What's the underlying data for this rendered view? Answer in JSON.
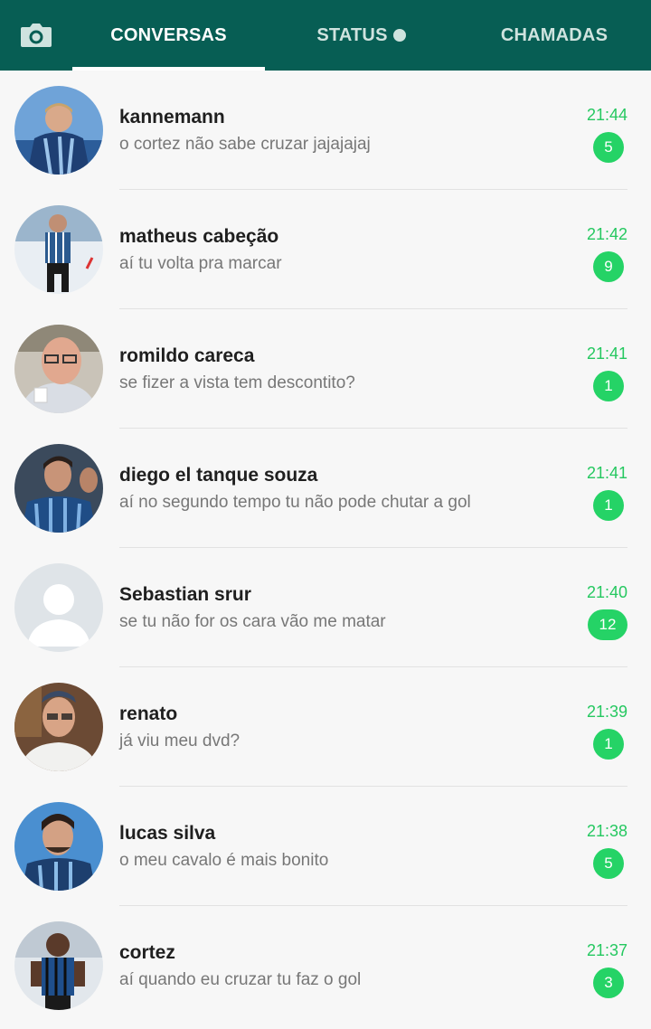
{
  "header": {
    "camera_icon": "camera-icon",
    "tabs": [
      {
        "label": "CONVERSAS",
        "active": true
      },
      {
        "label": "STATUS",
        "active": false
      },
      {
        "label": "CHAMADAS",
        "active": false
      }
    ],
    "colors": {
      "bar": "#075e54",
      "accent": "#25d366"
    }
  },
  "chats": [
    {
      "name": "kannemann",
      "message": "o cortez não sabe cruzar jajajajaj",
      "time": "21:44",
      "unread": "5",
      "avatar": "player-photo-blue-jersey"
    },
    {
      "name": "matheus cabeção",
      "message": "aí tu volta pra marcar",
      "time": "21:42",
      "unread": "9",
      "avatar": "player-photo-running"
    },
    {
      "name": "romildo careca",
      "message": "se fizer a vista tem descontito?",
      "time": "21:41",
      "unread": "1",
      "avatar": "man-with-glasses-photo"
    },
    {
      "name": "diego el tanque souza",
      "message": "aí no segundo tempo tu não pode chutar a gol",
      "time": "21:41",
      "unread": "1",
      "avatar": "player-photo-celebrating"
    },
    {
      "name": "Sebastian srur",
      "message": "se tu não for os cara vão me matar",
      "time": "21:40",
      "unread": "12",
      "avatar": "default-person-placeholder"
    },
    {
      "name": "renato",
      "message": "já viu meu dvd?",
      "time": "21:39",
      "unread": "1",
      "avatar": "man-white-shirt-photo"
    },
    {
      "name": "lucas silva",
      "message": "o meu cavalo é mais bonito",
      "time": "21:38",
      "unread": "5",
      "avatar": "player-photo-portrait"
    },
    {
      "name": "cortez",
      "message": "aí quando eu cruzar tu faz o gol",
      "time": "21:37",
      "unread": "3",
      "avatar": "player-photo-dark-jersey"
    }
  ]
}
